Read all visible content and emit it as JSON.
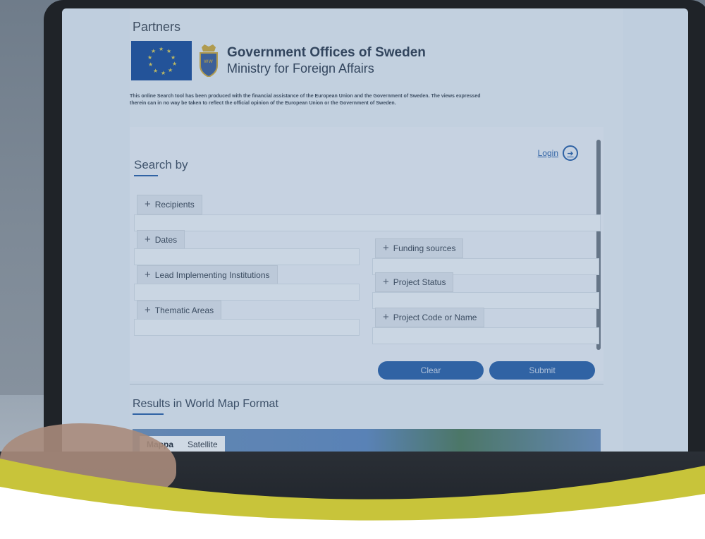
{
  "partners": {
    "title": "Partners"
  },
  "government": {
    "line1": "Government Offices of Sweden",
    "line2": "Ministry for Foreign Affairs"
  },
  "disclaimer": "This online Search tool has been produced with the financial assistance of the European Union and the Government of Sweden. The views expressed therein can in no way be taken to reflect the official opinion of the European Union or the Government of Sweden.",
  "header": {
    "login_label": "Login",
    "login_icon": "login-arrow-icon"
  },
  "search": {
    "title": "Search by",
    "filters": {
      "recipients": "Recipients",
      "dates": "Dates",
      "funding_sources": "Funding sources",
      "lead_institutions": "Lead Implementing Institutions",
      "project_status": "Project Status",
      "thematic_areas": "Thematic Areas",
      "project_code": "Project Code or Name"
    },
    "plus_glyph": "+",
    "clear_label": "Clear",
    "submit_label": "Submit"
  },
  "results": {
    "title_prefix": "Results",
    "title_rest": " in World Map Format",
    "map_tabs": [
      "Mappa",
      "Satellite"
    ]
  },
  "keyboard": {
    "keys": [
      "/",
      "/",
      "?",
      ";",
      ":",
      "-",
      "+"
    ]
  },
  "colors": {
    "accent": "#2d62a8",
    "wave_yellow": "#c8c43a",
    "screen_background": "#dbe4ee"
  }
}
